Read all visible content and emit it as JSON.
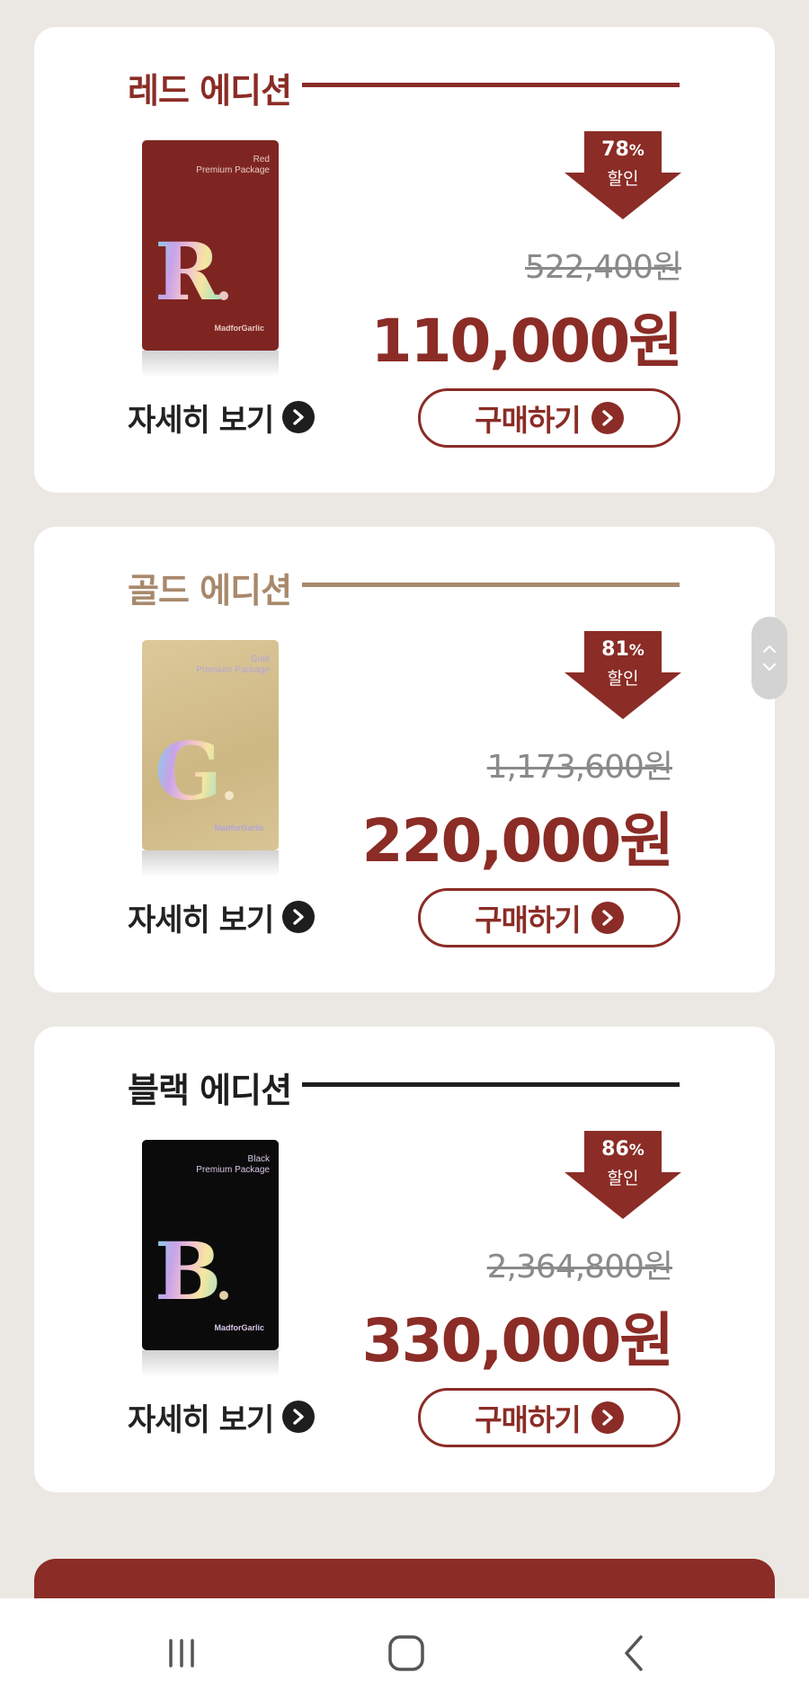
{
  "products": [
    {
      "title": "레드 에디션",
      "theme_color": "#8b2c26",
      "line_color": "#8b2c26",
      "package": {
        "name": "Red\nPremium Package",
        "letter": "R",
        "brand": "MadforGarlic",
        "background": "#7e2522",
        "text_color": "#e9c9c4",
        "dot_color": "#e8c8c0"
      },
      "discount": {
        "percent": "78",
        "percent_sign": "%",
        "label": "할인"
      },
      "original_price": "522,400원",
      "sale_price": "110,000원",
      "detail_label": "자세히 보기",
      "buy_label": "구매하기"
    },
    {
      "title": "골드 에디션",
      "theme_color": "#a8896c",
      "line_color": "#a8896c",
      "package": {
        "name": "Gold\nPremium Package",
        "letter": "G",
        "brand": "MadforGarlic",
        "background": "#d6c290",
        "text_color": "#b2a6d8",
        "dot_color": "#f0e6c8"
      },
      "discount": {
        "percent": "81",
        "percent_sign": "%",
        "label": "할인"
      },
      "original_price": "1,173,600원",
      "sale_price": "220,000원",
      "detail_label": "자세히 보기",
      "buy_label": "구매하기"
    },
    {
      "title": "블랙 에디션",
      "theme_color": "#1e1e1e",
      "line_color": "#1e1e1e",
      "package": {
        "name": "Black\nPremium Package",
        "letter": "B",
        "brand": "MadforGarlic",
        "background": "#0b0b0b",
        "text_color": "#d8c8e8",
        "dot_color": "#e0d0a8"
      },
      "discount": {
        "percent": "86",
        "percent_sign": "%",
        "label": "할인"
      },
      "original_price": "2,364,800원",
      "sale_price": "330,000원",
      "detail_label": "자세히 보기",
      "buy_label": "구매하기"
    }
  ],
  "colors": {
    "accent": "#8b2c26",
    "page_background": "#ebe8e4",
    "detail_icon": "#1e1e1e"
  },
  "icons": {
    "detail": "chevron-right-circle-icon",
    "buy": "chevron-right-circle-icon",
    "scroll_up": "chevron-up-icon",
    "scroll_down": "chevron-down-icon",
    "nav_recent": "recent-apps-icon",
    "nav_home": "home-icon",
    "nav_back": "back-icon"
  }
}
